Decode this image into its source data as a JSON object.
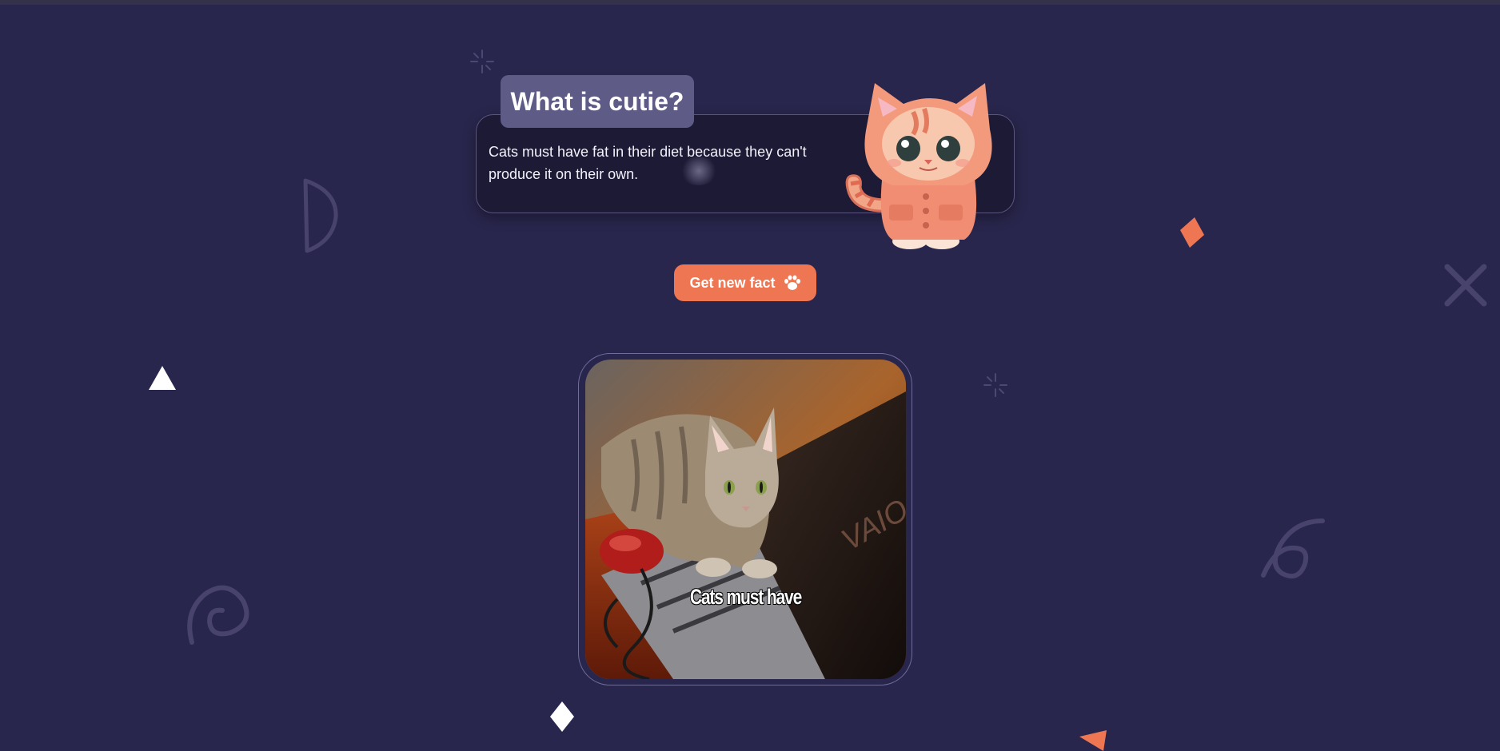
{
  "card": {
    "title": "What is cutie?",
    "fact": "Cats must have fat in their diet because they can't produce it on their own."
  },
  "actions": {
    "new_fact_label": "Get new fact"
  },
  "photo": {
    "caption": "Cats must have"
  },
  "colors": {
    "background": "#29264d",
    "accent": "#ef7652",
    "card": "#1d1a36",
    "title_tab": "#5e5b87"
  },
  "icons": {
    "button_icon": "paw-icon",
    "mascot": "cat-mascot-illustration"
  }
}
